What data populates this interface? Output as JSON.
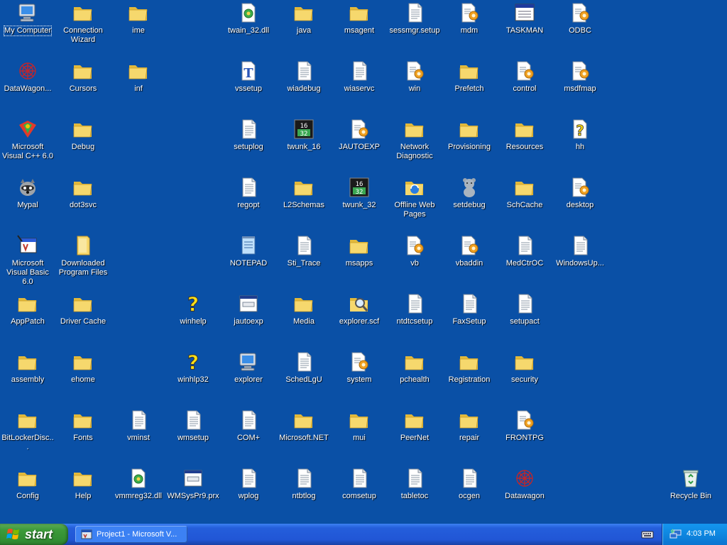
{
  "desktop": {
    "icons": [
      {
        "label": "My Computer",
        "icon": "computer-icon",
        "col": 0,
        "row": 0,
        "selected": true
      },
      {
        "label": "DataWagon...",
        "icon": "datawagon-icon",
        "col": 0,
        "row": 1
      },
      {
        "label": "Microsoft Visual C++ 6.0",
        "icon": "visual-cpp-icon",
        "col": 0,
        "row": 2
      },
      {
        "label": "Mypal",
        "icon": "raccoon-icon",
        "col": 0,
        "row": 3
      },
      {
        "label": "Microsoft Visual Basic 6.0",
        "icon": "visual-basic-icon",
        "col": 0,
        "row": 4
      },
      {
        "label": "AppPatch",
        "icon": "folder-icon",
        "col": 0,
        "row": 5
      },
      {
        "label": "assembly",
        "icon": "folder-icon",
        "col": 0,
        "row": 6
      },
      {
        "label": "BitLockerDisc...",
        "icon": "folder-icon",
        "col": 0,
        "row": 7
      },
      {
        "label": "Config",
        "icon": "folder-icon",
        "col": 0,
        "row": 8
      },
      {
        "label": "Connection Wizard",
        "icon": "folder-icon",
        "col": 1,
        "row": 0
      },
      {
        "label": "Cursors",
        "icon": "folder-icon",
        "col": 1,
        "row": 1
      },
      {
        "label": "Debug",
        "icon": "folder-icon",
        "col": 1,
        "row": 2
      },
      {
        "label": "dot3svc",
        "icon": "folder-icon",
        "col": 1,
        "row": 3
      },
      {
        "label": "Downloaded Program Files",
        "icon": "folder-special-icon",
        "col": 1,
        "row": 4
      },
      {
        "label": "Driver Cache",
        "icon": "folder-icon",
        "col": 1,
        "row": 5
      },
      {
        "label": "ehome",
        "icon": "folder-icon",
        "col": 1,
        "row": 6
      },
      {
        "label": "Fonts",
        "icon": "folder-icon",
        "col": 1,
        "row": 7
      },
      {
        "label": "Help",
        "icon": "folder-icon",
        "col": 1,
        "row": 8
      },
      {
        "label": "ime",
        "icon": "folder-icon",
        "col": 2,
        "row": 0
      },
      {
        "label": "inf",
        "icon": "folder-icon",
        "col": 2,
        "row": 1
      },
      {
        "label": "vminst",
        "icon": "text-file-icon",
        "col": 2,
        "row": 7
      },
      {
        "label": "vmmreg32.dll",
        "icon": "dll-icon",
        "col": 2,
        "row": 8
      },
      {
        "label": "winhelp",
        "icon": "help-icon",
        "col": 3,
        "row": 5
      },
      {
        "label": "winhlp32",
        "icon": "help-icon",
        "col": 3,
        "row": 6
      },
      {
        "label": "wmsetup",
        "icon": "text-file-icon",
        "col": 3,
        "row": 7
      },
      {
        "label": "WMSysPr9.prx",
        "icon": "window-file-icon",
        "col": 3,
        "row": 8
      },
      {
        "label": "twain_32.dll",
        "icon": "dll-icon",
        "col": 4,
        "row": 0
      },
      {
        "label": "vssetup",
        "icon": "font-file-icon",
        "col": 4,
        "row": 1
      },
      {
        "label": "setuplog",
        "icon": "text-file-icon",
        "col": 4,
        "row": 2
      },
      {
        "label": "regopt",
        "icon": "text-file-icon",
        "col": 4,
        "row": 3
      },
      {
        "label": "NOTEPAD",
        "icon": "notepad-icon",
        "col": 4,
        "row": 4
      },
      {
        "label": "jautoexp",
        "icon": "window-file-icon",
        "col": 4,
        "row": 5
      },
      {
        "label": "explorer",
        "icon": "computer-icon",
        "col": 4,
        "row": 6
      },
      {
        "label": "COM+",
        "icon": "text-file-icon",
        "col": 4,
        "row": 7
      },
      {
        "label": "wplog",
        "icon": "text-file-icon",
        "col": 4,
        "row": 8
      },
      {
        "label": "java",
        "icon": "folder-icon",
        "col": 5,
        "row": 0
      },
      {
        "label": "wiadebug",
        "icon": "text-file-icon",
        "col": 5,
        "row": 1
      },
      {
        "label": "twunk_16",
        "icon": "twunk-icon",
        "col": 5,
        "row": 2
      },
      {
        "label": "L2Schemas",
        "icon": "folder-icon",
        "col": 5,
        "row": 3
      },
      {
        "label": "Sti_Trace",
        "icon": "text-file-icon",
        "col": 5,
        "row": 4
      },
      {
        "label": "Media",
        "icon": "folder-icon",
        "col": 5,
        "row": 5
      },
      {
        "label": "SchedLgU",
        "icon": "text-file-icon",
        "col": 5,
        "row": 6
      },
      {
        "label": "Microsoft.NET",
        "icon": "folder-icon",
        "col": 5,
        "row": 7
      },
      {
        "label": "ntbtlog",
        "icon": "text-file-icon",
        "col": 5,
        "row": 8
      },
      {
        "label": "msagent",
        "icon": "folder-icon",
        "col": 6,
        "row": 0
      },
      {
        "label": "wiaservc",
        "icon": "text-file-icon",
        "col": 6,
        "row": 1
      },
      {
        "label": "JAUTOEXP",
        "icon": "config-file-icon",
        "col": 6,
        "row": 2
      },
      {
        "label": "twunk_32",
        "icon": "twunk-icon",
        "col": 6,
        "row": 3
      },
      {
        "label": "msapps",
        "icon": "folder-icon",
        "col": 6,
        "row": 4
      },
      {
        "label": "explorer.scf",
        "icon": "explorer-search-icon",
        "col": 6,
        "row": 5
      },
      {
        "label": "system",
        "icon": "config-file-icon",
        "col": 6,
        "row": 6
      },
      {
        "label": "mui",
        "icon": "folder-icon",
        "col": 6,
        "row": 7
      },
      {
        "label": "comsetup",
        "icon": "text-file-icon",
        "col": 6,
        "row": 8
      },
      {
        "label": "sessmgr.setup",
        "icon": "text-file-icon",
        "col": 7,
        "row": 0
      },
      {
        "label": "win",
        "icon": "config-file-icon",
        "col": 7,
        "row": 1
      },
      {
        "label": "Network Diagnostic",
        "icon": "folder-icon",
        "col": 7,
        "row": 2
      },
      {
        "label": "Offline Web Pages",
        "icon": "offline-web-pages-icon",
        "col": 7,
        "row": 3
      },
      {
        "label": "vb",
        "icon": "config-file-icon",
        "col": 7,
        "row": 4
      },
      {
        "label": "ntdtcsetup",
        "icon": "text-file-icon",
        "col": 7,
        "row": 5
      },
      {
        "label": "pchealth",
        "icon": "folder-icon",
        "col": 7,
        "row": 6
      },
      {
        "label": "PeerNet",
        "icon": "folder-icon",
        "col": 7,
        "row": 7
      },
      {
        "label": "tabletoc",
        "icon": "text-file-icon",
        "col": 7,
        "row": 8
      },
      {
        "label": "mdm",
        "icon": "config-file-icon",
        "col": 8,
        "row": 0
      },
      {
        "label": "Prefetch",
        "icon": "folder-icon",
        "col": 8,
        "row": 1
      },
      {
        "label": "Provisioning",
        "icon": "folder-icon",
        "col": 8,
        "row": 2
      },
      {
        "label": "setdebug",
        "icon": "teddy-bear-icon",
        "col": 8,
        "row": 3
      },
      {
        "label": "vbaddin",
        "icon": "config-file-icon",
        "col": 8,
        "row": 4
      },
      {
        "label": "FaxSetup",
        "icon": "text-file-icon",
        "col": 8,
        "row": 5
      },
      {
        "label": "Registration",
        "icon": "folder-icon",
        "col": 8,
        "row": 6
      },
      {
        "label": "repair",
        "icon": "folder-icon",
        "col": 8,
        "row": 7
      },
      {
        "label": "ocgen",
        "icon": "text-file-icon",
        "col": 8,
        "row": 8
      },
      {
        "label": "TASKMAN",
        "icon": "taskman-icon",
        "col": 9,
        "row": 0
      },
      {
        "label": "control",
        "icon": "config-file-icon",
        "col": 9,
        "row": 1
      },
      {
        "label": "Resources",
        "icon": "folder-icon",
        "col": 9,
        "row": 2
      },
      {
        "label": "SchCache",
        "icon": "folder-icon",
        "col": 9,
        "row": 3
      },
      {
        "label": "MedCtrOC",
        "icon": "text-file-icon",
        "col": 9,
        "row": 4
      },
      {
        "label": "setupact",
        "icon": "text-file-icon",
        "col": 9,
        "row": 5
      },
      {
        "label": "security",
        "icon": "folder-icon",
        "col": 9,
        "row": 6
      },
      {
        "label": "FRONTPG",
        "icon": "config-file-icon",
        "col": 9,
        "row": 7
      },
      {
        "label": "Datawagon",
        "icon": "datawagon-icon",
        "col": 9,
        "row": 8
      },
      {
        "label": "ODBC",
        "icon": "config-file-icon",
        "col": 10,
        "row": 0
      },
      {
        "label": "msdfmap",
        "icon": "config-file-icon",
        "col": 10,
        "row": 1
      },
      {
        "label": "hh",
        "icon": "help-file-icon",
        "col": 10,
        "row": 2
      },
      {
        "label": "desktop",
        "icon": "config-file-icon",
        "col": 10,
        "row": 3
      },
      {
        "label": "WindowsUp...",
        "icon": "text-file-icon",
        "col": 10,
        "row": 4
      },
      {
        "label": "Recycle Bin",
        "icon": "recycle-bin-icon",
        "col": 12,
        "row": 8
      }
    ]
  },
  "taskbar": {
    "start_label": "start",
    "task_button_label": "Project1 - Microsoft V...",
    "clock": "4:03 PM"
  },
  "colors": {
    "desktop_bg": "#0a50a6",
    "folder": "#f5d96b",
    "start_green": "#3c9a3a",
    "taskbar_blue": "#245edb"
  }
}
